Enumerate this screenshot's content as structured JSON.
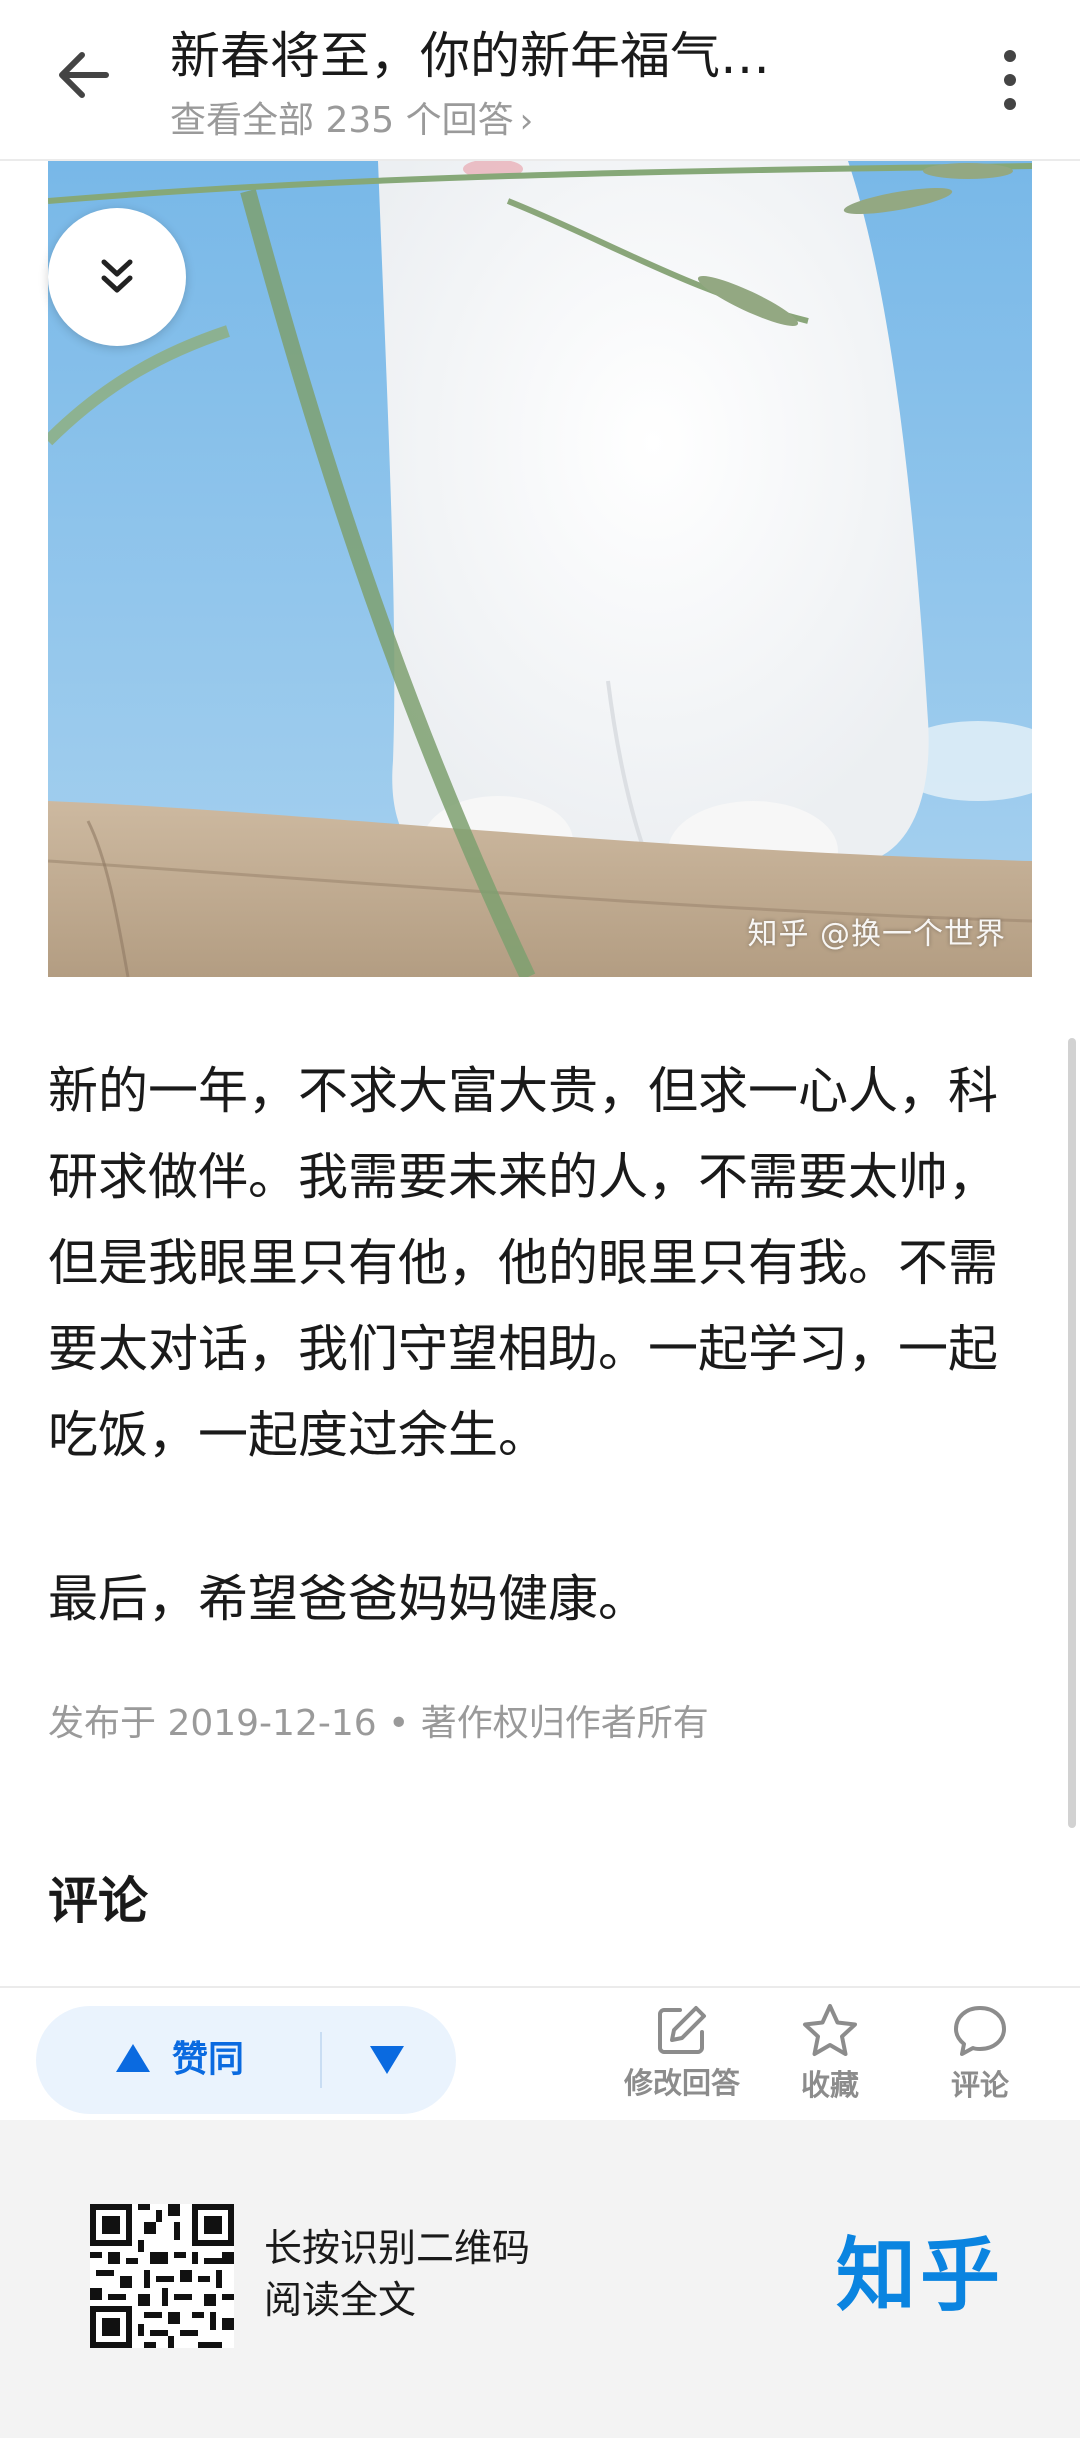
{
  "header": {
    "title": "新春将至，你的新年福气…",
    "subtitle": "查看全部 235 个回答",
    "subtitle_chevron": "›"
  },
  "image": {
    "watermark": "知乎 @换一个世界"
  },
  "article": {
    "paragraph1": "新的一年，不求大富大贵，但求一心人，科研求做伴。我需要未来的人，不需要太帅，但是我眼里只有他，他的眼里只有我。不需要太对话，我们守望相助。一起学习，一起吃饭，一起度过余生。",
    "paragraph2": "最后，希望爸爸妈妈健康。",
    "meta": "发布于 2019-12-16 • 著作权归作者所有"
  },
  "comments": {
    "title": "评论"
  },
  "actions": {
    "upvote_label": "赞同",
    "edit_label": "修改回答",
    "favorite_label": "收藏",
    "comment_label": "评论"
  },
  "footer": {
    "qr_line1": "长按识别二维码",
    "qr_line2": "阅读全文",
    "brand": "知乎"
  },
  "colors": {
    "accent": "#0a6ae0",
    "brand": "#0a84e0",
    "vote_bg": "#eaf3fd",
    "footer_bg": "#f3f3f3"
  },
  "icons": [
    "back-arrow-icon",
    "more-vert-icon",
    "chevron-double-down-icon",
    "upvote-triangle-icon",
    "downvote-triangle-icon",
    "edit-icon",
    "star-icon",
    "comment-bubble-icon",
    "qr-code-icon"
  ]
}
